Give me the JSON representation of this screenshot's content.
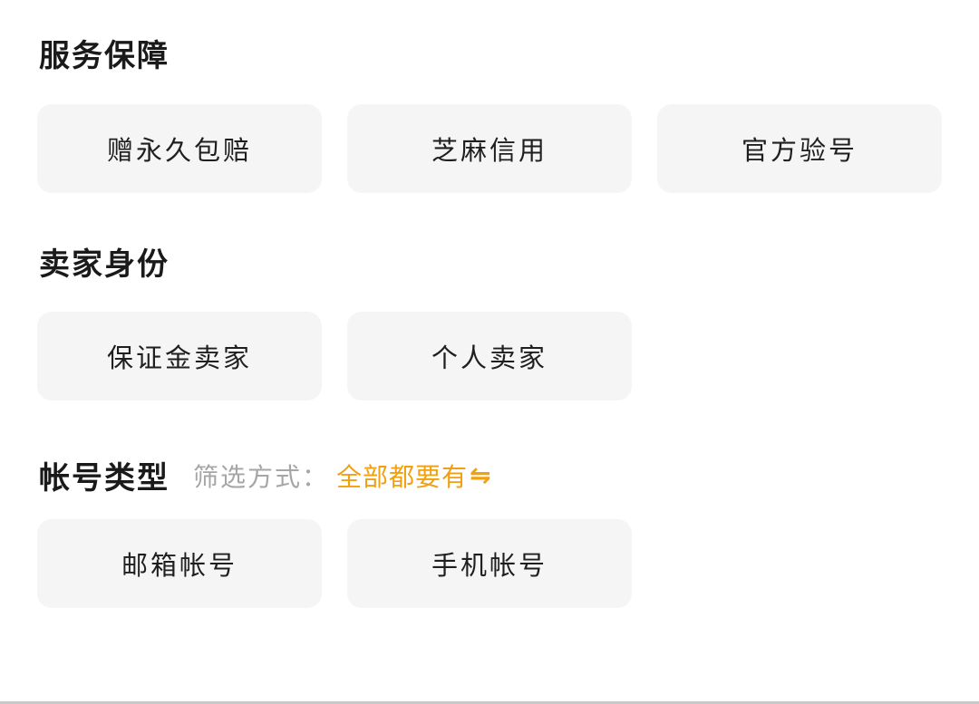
{
  "service": {
    "title": "服务保障",
    "options": [
      "赠永久包赔",
      "芝麻信用",
      "官方验号"
    ]
  },
  "seller": {
    "title": "卖家身份",
    "options": [
      "保证金卖家",
      "个人卖家"
    ]
  },
  "account": {
    "title": "帐号类型",
    "filter_label": "筛选方式：",
    "filter_value": "全部都要有",
    "filter_icon": "⇋",
    "options": [
      "邮箱帐号",
      "手机帐号"
    ]
  },
  "colors": {
    "chip_bg": "#f5f5f5",
    "accent": "#f0a010",
    "muted": "#a6a6a6"
  }
}
